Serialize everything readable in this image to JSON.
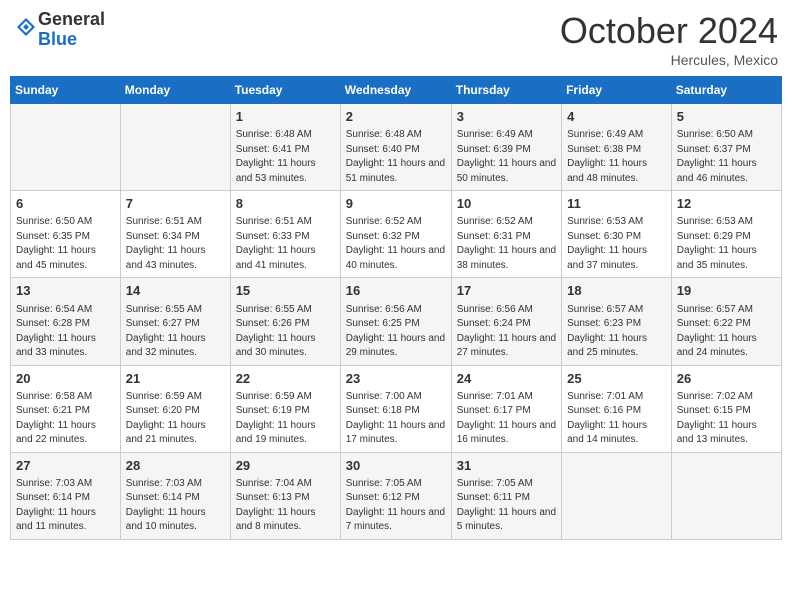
{
  "header": {
    "logo_general": "General",
    "logo_blue": "Blue",
    "month": "October 2024",
    "location": "Hercules, Mexico"
  },
  "weekdays": [
    "Sunday",
    "Monday",
    "Tuesday",
    "Wednesday",
    "Thursday",
    "Friday",
    "Saturday"
  ],
  "weeks": [
    [
      {
        "day": "",
        "sunrise": "",
        "sunset": "",
        "daylight": ""
      },
      {
        "day": "",
        "sunrise": "",
        "sunset": "",
        "daylight": ""
      },
      {
        "day": "1",
        "sunrise": "Sunrise: 6:48 AM",
        "sunset": "Sunset: 6:41 PM",
        "daylight": "Daylight: 11 hours and 53 minutes."
      },
      {
        "day": "2",
        "sunrise": "Sunrise: 6:48 AM",
        "sunset": "Sunset: 6:40 PM",
        "daylight": "Daylight: 11 hours and 51 minutes."
      },
      {
        "day": "3",
        "sunrise": "Sunrise: 6:49 AM",
        "sunset": "Sunset: 6:39 PM",
        "daylight": "Daylight: 11 hours and 50 minutes."
      },
      {
        "day": "4",
        "sunrise": "Sunrise: 6:49 AM",
        "sunset": "Sunset: 6:38 PM",
        "daylight": "Daylight: 11 hours and 48 minutes."
      },
      {
        "day": "5",
        "sunrise": "Sunrise: 6:50 AM",
        "sunset": "Sunset: 6:37 PM",
        "daylight": "Daylight: 11 hours and 46 minutes."
      }
    ],
    [
      {
        "day": "6",
        "sunrise": "Sunrise: 6:50 AM",
        "sunset": "Sunset: 6:35 PM",
        "daylight": "Daylight: 11 hours and 45 minutes."
      },
      {
        "day": "7",
        "sunrise": "Sunrise: 6:51 AM",
        "sunset": "Sunset: 6:34 PM",
        "daylight": "Daylight: 11 hours and 43 minutes."
      },
      {
        "day": "8",
        "sunrise": "Sunrise: 6:51 AM",
        "sunset": "Sunset: 6:33 PM",
        "daylight": "Daylight: 11 hours and 41 minutes."
      },
      {
        "day": "9",
        "sunrise": "Sunrise: 6:52 AM",
        "sunset": "Sunset: 6:32 PM",
        "daylight": "Daylight: 11 hours and 40 minutes."
      },
      {
        "day": "10",
        "sunrise": "Sunrise: 6:52 AM",
        "sunset": "Sunset: 6:31 PM",
        "daylight": "Daylight: 11 hours and 38 minutes."
      },
      {
        "day": "11",
        "sunrise": "Sunrise: 6:53 AM",
        "sunset": "Sunset: 6:30 PM",
        "daylight": "Daylight: 11 hours and 37 minutes."
      },
      {
        "day": "12",
        "sunrise": "Sunrise: 6:53 AM",
        "sunset": "Sunset: 6:29 PM",
        "daylight": "Daylight: 11 hours and 35 minutes."
      }
    ],
    [
      {
        "day": "13",
        "sunrise": "Sunrise: 6:54 AM",
        "sunset": "Sunset: 6:28 PM",
        "daylight": "Daylight: 11 hours and 33 minutes."
      },
      {
        "day": "14",
        "sunrise": "Sunrise: 6:55 AM",
        "sunset": "Sunset: 6:27 PM",
        "daylight": "Daylight: 11 hours and 32 minutes."
      },
      {
        "day": "15",
        "sunrise": "Sunrise: 6:55 AM",
        "sunset": "Sunset: 6:26 PM",
        "daylight": "Daylight: 11 hours and 30 minutes."
      },
      {
        "day": "16",
        "sunrise": "Sunrise: 6:56 AM",
        "sunset": "Sunset: 6:25 PM",
        "daylight": "Daylight: 11 hours and 29 minutes."
      },
      {
        "day": "17",
        "sunrise": "Sunrise: 6:56 AM",
        "sunset": "Sunset: 6:24 PM",
        "daylight": "Daylight: 11 hours and 27 minutes."
      },
      {
        "day": "18",
        "sunrise": "Sunrise: 6:57 AM",
        "sunset": "Sunset: 6:23 PM",
        "daylight": "Daylight: 11 hours and 25 minutes."
      },
      {
        "day": "19",
        "sunrise": "Sunrise: 6:57 AM",
        "sunset": "Sunset: 6:22 PM",
        "daylight": "Daylight: 11 hours and 24 minutes."
      }
    ],
    [
      {
        "day": "20",
        "sunrise": "Sunrise: 6:58 AM",
        "sunset": "Sunset: 6:21 PM",
        "daylight": "Daylight: 11 hours and 22 minutes."
      },
      {
        "day": "21",
        "sunrise": "Sunrise: 6:59 AM",
        "sunset": "Sunset: 6:20 PM",
        "daylight": "Daylight: 11 hours and 21 minutes."
      },
      {
        "day": "22",
        "sunrise": "Sunrise: 6:59 AM",
        "sunset": "Sunset: 6:19 PM",
        "daylight": "Daylight: 11 hours and 19 minutes."
      },
      {
        "day": "23",
        "sunrise": "Sunrise: 7:00 AM",
        "sunset": "Sunset: 6:18 PM",
        "daylight": "Daylight: 11 hours and 17 minutes."
      },
      {
        "day": "24",
        "sunrise": "Sunrise: 7:01 AM",
        "sunset": "Sunset: 6:17 PM",
        "daylight": "Daylight: 11 hours and 16 minutes."
      },
      {
        "day": "25",
        "sunrise": "Sunrise: 7:01 AM",
        "sunset": "Sunset: 6:16 PM",
        "daylight": "Daylight: 11 hours and 14 minutes."
      },
      {
        "day": "26",
        "sunrise": "Sunrise: 7:02 AM",
        "sunset": "Sunset: 6:15 PM",
        "daylight": "Daylight: 11 hours and 13 minutes."
      }
    ],
    [
      {
        "day": "27",
        "sunrise": "Sunrise: 7:03 AM",
        "sunset": "Sunset: 6:14 PM",
        "daylight": "Daylight: 11 hours and 11 minutes."
      },
      {
        "day": "28",
        "sunrise": "Sunrise: 7:03 AM",
        "sunset": "Sunset: 6:14 PM",
        "daylight": "Daylight: 11 hours and 10 minutes."
      },
      {
        "day": "29",
        "sunrise": "Sunrise: 7:04 AM",
        "sunset": "Sunset: 6:13 PM",
        "daylight": "Daylight: 11 hours and 8 minutes."
      },
      {
        "day": "30",
        "sunrise": "Sunrise: 7:05 AM",
        "sunset": "Sunset: 6:12 PM",
        "daylight": "Daylight: 11 hours and 7 minutes."
      },
      {
        "day": "31",
        "sunrise": "Sunrise: 7:05 AM",
        "sunset": "Sunset: 6:11 PM",
        "daylight": "Daylight: 11 hours and 5 minutes."
      },
      {
        "day": "",
        "sunrise": "",
        "sunset": "",
        "daylight": ""
      },
      {
        "day": "",
        "sunrise": "",
        "sunset": "",
        "daylight": ""
      }
    ]
  ]
}
